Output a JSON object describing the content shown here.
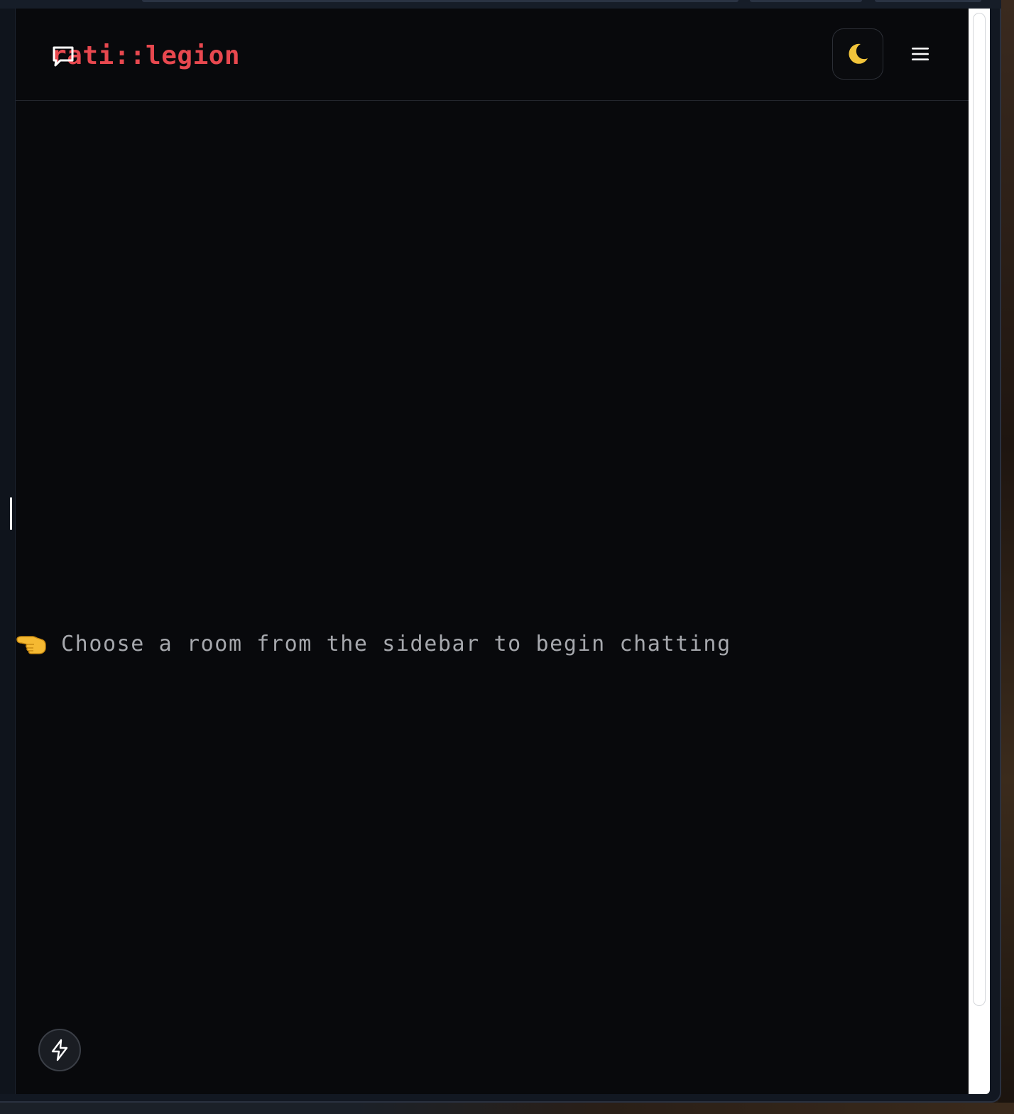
{
  "header": {
    "title": "rati::legion",
    "logo_icon": "chat-bubble-icon",
    "theme_toggle_icon": "crescent-moon-icon",
    "menu_icon": "hamburger-menu-icon"
  },
  "main": {
    "empty_state": {
      "icon": "pointing-left-hand-icon",
      "text": "Choose a room from the sidebar to begin chatting"
    }
  },
  "fab": {
    "icon": "lightning-bolt-icon"
  },
  "colors": {
    "background": "#08090c",
    "brand": "#e8484f",
    "muted_text": "#a6a8ad",
    "moon": "#f2c43a",
    "border": "#2c2f36"
  }
}
